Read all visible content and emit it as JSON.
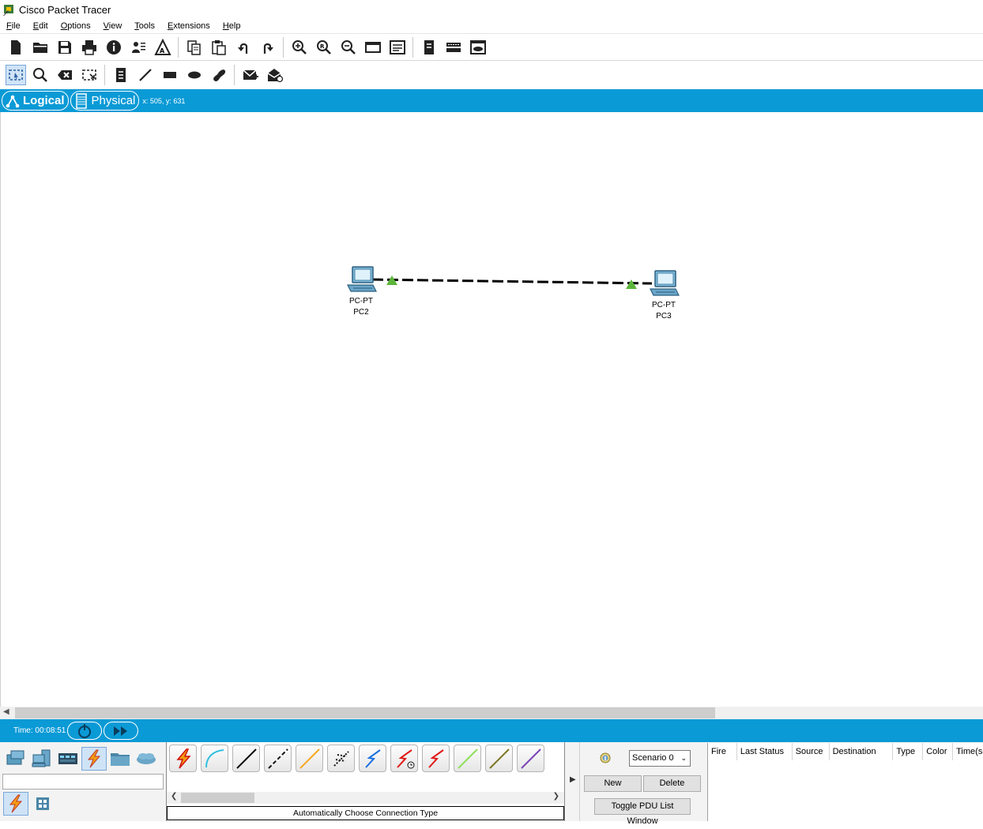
{
  "window": {
    "title": "Cisco Packet Tracer"
  },
  "menu": [
    {
      "key": "F",
      "rest": "ile"
    },
    {
      "key": "E",
      "rest": "dit"
    },
    {
      "key": "O",
      "rest": "ptions"
    },
    {
      "key": "V",
      "rest": "iew"
    },
    {
      "key": "T",
      "rest": "ools"
    },
    {
      "key": "E",
      "rest": "xtensions"
    },
    {
      "key": "H",
      "rest": "elp"
    }
  ],
  "view_tabs": {
    "logical": "Logical",
    "physical": "Physical",
    "coords": "x: 505, y: 631"
  },
  "devices": [
    {
      "model": "PC-PT",
      "name": "PC2"
    },
    {
      "model": "PC-PT",
      "name": "PC3"
    }
  ],
  "link": {
    "type": "crossover",
    "status_color": "#5cb53a"
  },
  "sim": {
    "time": "Time: 00:08:51"
  },
  "connection_status": "Automatically Choose Connection Type",
  "scenario": {
    "selected": "Scenario 0",
    "new": "New",
    "delete": "Delete",
    "toggle": "Toggle PDU List Window"
  },
  "pdu_columns": [
    "Fire",
    "Last Status",
    "Source",
    "Destination",
    "Type",
    "Color",
    "Time(sec)"
  ],
  "colors": {
    "accent_bar": "#0a9ad6",
    "selection": "#cfe3f7"
  }
}
